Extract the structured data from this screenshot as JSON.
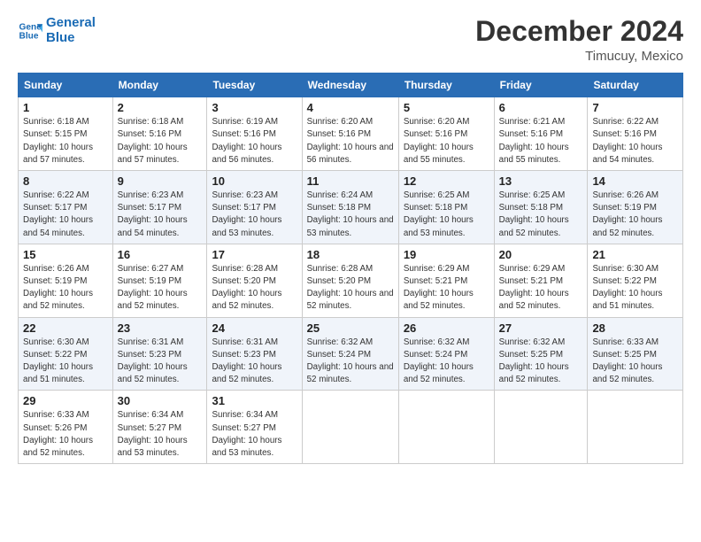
{
  "logo": {
    "line1": "General",
    "line2": "Blue"
  },
  "title": "December 2024",
  "location": "Timucuy, Mexico",
  "weekdays": [
    "Sunday",
    "Monday",
    "Tuesday",
    "Wednesday",
    "Thursday",
    "Friday",
    "Saturday"
  ],
  "weeks": [
    [
      {
        "day": "1",
        "sunrise": "6:18 AM",
        "sunset": "5:15 PM",
        "daylight": "10 hours and 57 minutes."
      },
      {
        "day": "2",
        "sunrise": "6:18 AM",
        "sunset": "5:16 PM",
        "daylight": "10 hours and 57 minutes."
      },
      {
        "day": "3",
        "sunrise": "6:19 AM",
        "sunset": "5:16 PM",
        "daylight": "10 hours and 56 minutes."
      },
      {
        "day": "4",
        "sunrise": "6:20 AM",
        "sunset": "5:16 PM",
        "daylight": "10 hours and 56 minutes."
      },
      {
        "day": "5",
        "sunrise": "6:20 AM",
        "sunset": "5:16 PM",
        "daylight": "10 hours and 55 minutes."
      },
      {
        "day": "6",
        "sunrise": "6:21 AM",
        "sunset": "5:16 PM",
        "daylight": "10 hours and 55 minutes."
      },
      {
        "day": "7",
        "sunrise": "6:22 AM",
        "sunset": "5:16 PM",
        "daylight": "10 hours and 54 minutes."
      }
    ],
    [
      {
        "day": "8",
        "sunrise": "6:22 AM",
        "sunset": "5:17 PM",
        "daylight": "10 hours and 54 minutes."
      },
      {
        "day": "9",
        "sunrise": "6:23 AM",
        "sunset": "5:17 PM",
        "daylight": "10 hours and 54 minutes."
      },
      {
        "day": "10",
        "sunrise": "6:23 AM",
        "sunset": "5:17 PM",
        "daylight": "10 hours and 53 minutes."
      },
      {
        "day": "11",
        "sunrise": "6:24 AM",
        "sunset": "5:18 PM",
        "daylight": "10 hours and 53 minutes."
      },
      {
        "day": "12",
        "sunrise": "6:25 AM",
        "sunset": "5:18 PM",
        "daylight": "10 hours and 53 minutes."
      },
      {
        "day": "13",
        "sunrise": "6:25 AM",
        "sunset": "5:18 PM",
        "daylight": "10 hours and 52 minutes."
      },
      {
        "day": "14",
        "sunrise": "6:26 AM",
        "sunset": "5:19 PM",
        "daylight": "10 hours and 52 minutes."
      }
    ],
    [
      {
        "day": "15",
        "sunrise": "6:26 AM",
        "sunset": "5:19 PM",
        "daylight": "10 hours and 52 minutes."
      },
      {
        "day": "16",
        "sunrise": "6:27 AM",
        "sunset": "5:19 PM",
        "daylight": "10 hours and 52 minutes."
      },
      {
        "day": "17",
        "sunrise": "6:28 AM",
        "sunset": "5:20 PM",
        "daylight": "10 hours and 52 minutes."
      },
      {
        "day": "18",
        "sunrise": "6:28 AM",
        "sunset": "5:20 PM",
        "daylight": "10 hours and 52 minutes."
      },
      {
        "day": "19",
        "sunrise": "6:29 AM",
        "sunset": "5:21 PM",
        "daylight": "10 hours and 52 minutes."
      },
      {
        "day": "20",
        "sunrise": "6:29 AM",
        "sunset": "5:21 PM",
        "daylight": "10 hours and 52 minutes."
      },
      {
        "day": "21",
        "sunrise": "6:30 AM",
        "sunset": "5:22 PM",
        "daylight": "10 hours and 51 minutes."
      }
    ],
    [
      {
        "day": "22",
        "sunrise": "6:30 AM",
        "sunset": "5:22 PM",
        "daylight": "10 hours and 51 minutes."
      },
      {
        "day": "23",
        "sunrise": "6:31 AM",
        "sunset": "5:23 PM",
        "daylight": "10 hours and 52 minutes."
      },
      {
        "day": "24",
        "sunrise": "6:31 AM",
        "sunset": "5:23 PM",
        "daylight": "10 hours and 52 minutes."
      },
      {
        "day": "25",
        "sunrise": "6:32 AM",
        "sunset": "5:24 PM",
        "daylight": "10 hours and 52 minutes."
      },
      {
        "day": "26",
        "sunrise": "6:32 AM",
        "sunset": "5:24 PM",
        "daylight": "10 hours and 52 minutes."
      },
      {
        "day": "27",
        "sunrise": "6:32 AM",
        "sunset": "5:25 PM",
        "daylight": "10 hours and 52 minutes."
      },
      {
        "day": "28",
        "sunrise": "6:33 AM",
        "sunset": "5:25 PM",
        "daylight": "10 hours and 52 minutes."
      }
    ],
    [
      {
        "day": "29",
        "sunrise": "6:33 AM",
        "sunset": "5:26 PM",
        "daylight": "10 hours and 52 minutes."
      },
      {
        "day": "30",
        "sunrise": "6:34 AM",
        "sunset": "5:27 PM",
        "daylight": "10 hours and 53 minutes."
      },
      {
        "day": "31",
        "sunrise": "6:34 AM",
        "sunset": "5:27 PM",
        "daylight": "10 hours and 53 minutes."
      },
      null,
      null,
      null,
      null
    ]
  ]
}
